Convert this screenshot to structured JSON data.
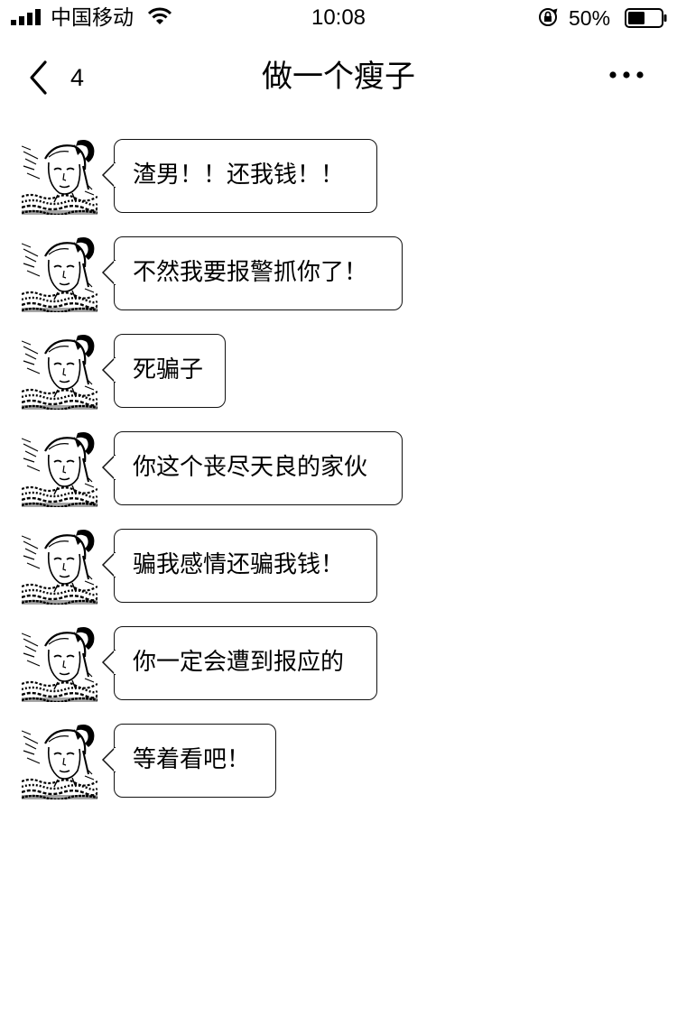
{
  "status_bar": {
    "carrier": "中国移动",
    "time": "10:08",
    "battery": "50%"
  },
  "nav": {
    "back_count": "4",
    "title": "做一个瘦子"
  },
  "messages": [
    {
      "text": "渣男！！还我钱！！"
    },
    {
      "text": "不然我要报警抓你了！"
    },
    {
      "text": "死骗子"
    },
    {
      "text": "你这个丧尽天良的家伙"
    },
    {
      "text": "骗我感情还骗我钱！"
    },
    {
      "text": "你一定会遭到报应的"
    },
    {
      "text": "等着看吧！"
    }
  ],
  "icons": {
    "signal": "signal-bars-icon",
    "wifi": "wifi-icon",
    "lock": "rotation-lock-icon",
    "battery": "battery-icon",
    "back": "chevron-left-icon",
    "more": "more-dots-icon"
  }
}
